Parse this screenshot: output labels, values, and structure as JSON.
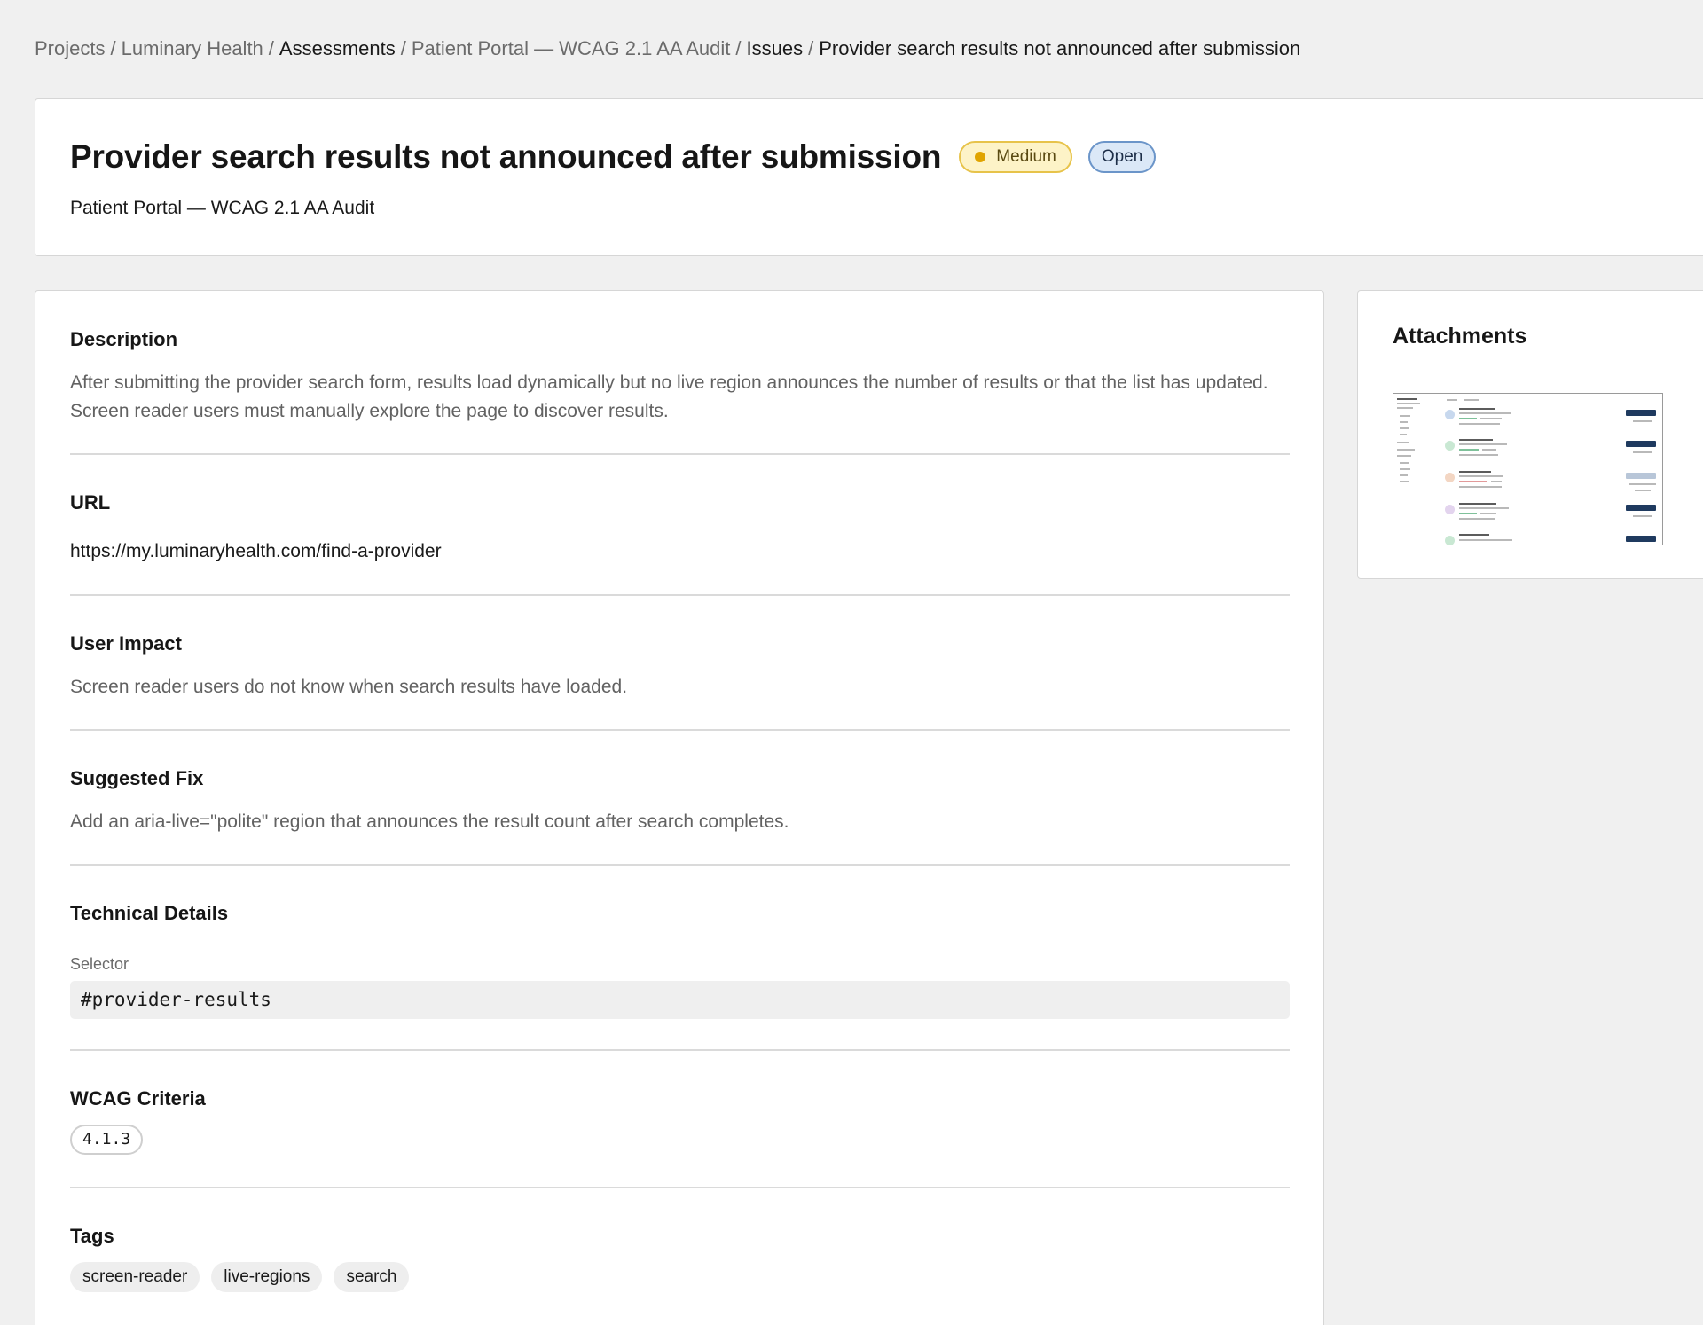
{
  "breadcrumb": [
    {
      "label": "Projects",
      "dark": false
    },
    {
      "label": "Luminary Health",
      "dark": false
    },
    {
      "label": "Assessments",
      "dark": true
    },
    {
      "label": "Patient Portal — WCAG 2.1 AA Audit",
      "dark": false
    },
    {
      "label": "Issues",
      "dark": true
    },
    {
      "label": "Provider search results not announced after submission",
      "dark": true
    }
  ],
  "breadcrumb_separator": "/",
  "header": {
    "title": "Provider search results not announced after submission",
    "severity": "Medium",
    "status": "Open",
    "subtitle": "Patient Portal — WCAG 2.1 AA Audit"
  },
  "colors": {
    "severity_dot": "#e0a400",
    "severity_bg": "#fdf3c7",
    "status_bg": "#dbe8f7",
    "page_bg": "#f0f0f0"
  },
  "sections": {
    "description": {
      "heading": "Description",
      "text": "After submitting the provider search form, results load dynamically but no live region announces the number of results or that the list has updated. Screen reader users must manually explore the page to discover results."
    },
    "url": {
      "heading": "URL",
      "text": "https://my.luminaryhealth.com/find-a-provider"
    },
    "user_impact": {
      "heading": "User Impact",
      "text": "Screen reader users do not know when search results have loaded."
    },
    "suggested_fix": {
      "heading": "Suggested Fix",
      "text": "Add an aria-live=\"polite\" region that announces the result count after search completes."
    },
    "technical_details": {
      "heading": "Technical Details",
      "selector_label": "Selector",
      "selector_value": "#provider-results"
    },
    "wcag_criteria": {
      "heading": "WCAG Criteria",
      "items": [
        "4.1.3"
      ]
    },
    "tags": {
      "heading": "Tags",
      "items": [
        "screen-reader",
        "live-regions",
        "search"
      ]
    }
  },
  "attachments": {
    "heading": "Attachments",
    "thumbnail_icon": "screenshot-thumbnail"
  }
}
